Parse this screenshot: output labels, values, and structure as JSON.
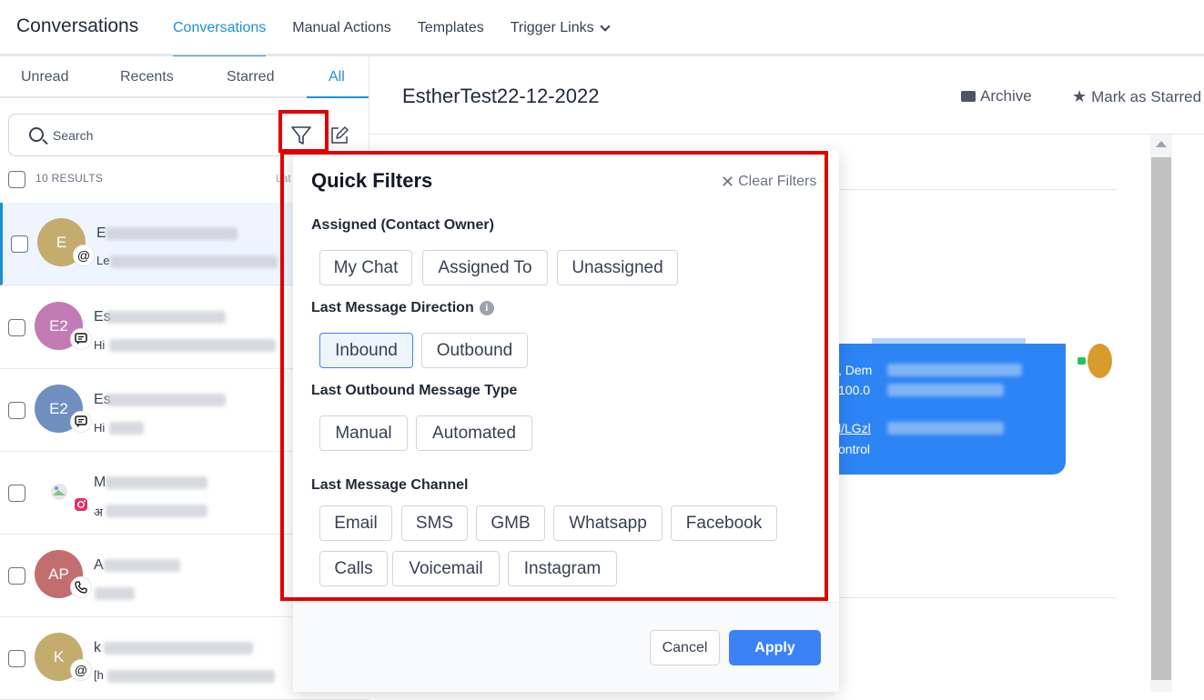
{
  "header": {
    "app_title": "Conversations",
    "tabs": [
      {
        "label": "Conversations",
        "active": true
      },
      {
        "label": "Manual Actions"
      },
      {
        "label": "Templates"
      },
      {
        "label": "Trigger Links",
        "has_dropdown": true
      }
    ]
  },
  "sidebar": {
    "tabs": [
      "Unread",
      "Recents",
      "Starred",
      "All"
    ],
    "active_tab": "All",
    "search_placeholder": "Search",
    "results_label": "10 RESULTS",
    "sort_label": "Lat",
    "conversations": [
      {
        "initials": "E",
        "color": "#c3ac6e",
        "badge": "at-icon",
        "name_start": "E",
        "preview_start": "Le",
        "selected": true
      },
      {
        "initials": "E2",
        "color": "#c27bb5",
        "badge": "chat-icon",
        "name_start": "Es",
        "preview_start": "Hi"
      },
      {
        "initials": "E2",
        "color": "#6e8fc0",
        "badge": "chat-icon",
        "name_start": "Es",
        "preview_start": "Hi"
      },
      {
        "initials": "",
        "color": "#ffffff",
        "badge": "instagram-icon",
        "name_start": "M",
        "preview_start": "अ"
      },
      {
        "initials": "AP",
        "color": "#c26e6e",
        "badge": "phone-icon",
        "name_start": "A",
        "preview_start": ""
      },
      {
        "initials": "K",
        "color": "#c3ac6e",
        "badge": "at-icon",
        "name_start": "k",
        "preview_start": "[h"
      }
    ]
  },
  "main": {
    "contact_title": "EstherTest22-12-2022",
    "archive_label": "Archive",
    "star_label": "Mark as Starred",
    "message_fragments": [
      ", Dem",
      "100.0",
      "l/LGzl",
      "ontrol"
    ]
  },
  "quick_filters": {
    "title": "Quick Filters",
    "clear_label": "Clear Filters",
    "sections": {
      "assigned": {
        "label": "Assigned (Contact Owner)",
        "options": [
          "My Chat",
          "Assigned To",
          "Unassigned"
        ]
      },
      "direction": {
        "label": "Last Message Direction",
        "options": [
          "Inbound",
          "Outbound"
        ],
        "selected": "Inbound"
      },
      "outbound_type": {
        "label": "Last Outbound Message Type",
        "options": [
          "Manual",
          "Automated"
        ]
      },
      "channel": {
        "label": "Last Message Channel",
        "options": [
          "Email",
          "SMS",
          "GMB",
          "Whatsapp",
          "Facebook",
          "Calls",
          "Voicemail",
          "Instagram"
        ]
      }
    },
    "cancel_label": "Cancel",
    "apply_label": "Apply"
  },
  "colors": {
    "accent": "#1d8fdc",
    "apply_button": "#3b82f6",
    "highlight": "#e00000",
    "message_bubble": "#2d84f5"
  }
}
